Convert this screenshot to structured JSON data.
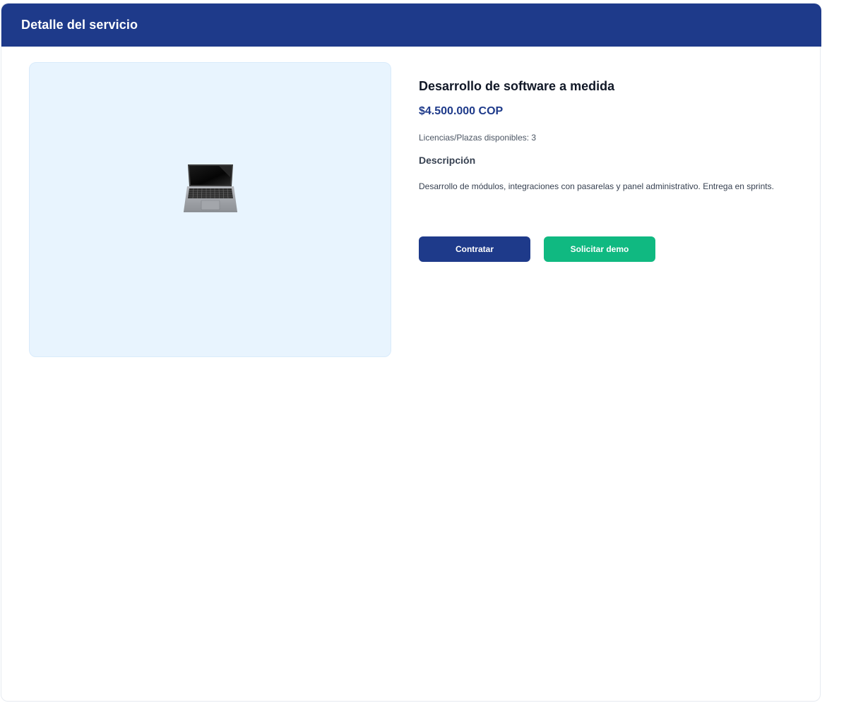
{
  "header": {
    "title": "Detalle del servicio"
  },
  "product": {
    "image_icon": "laptop-icon",
    "title": "Desarrollo de software a medida",
    "price": "$4.500.000 COP",
    "stock": "Licencias/Plazas disponibles: 3",
    "description_heading": "Descripción",
    "description": "Desarrollo de módulos, integraciones con pasarelas y panel administrativo. Entrega en sprints."
  },
  "actions": {
    "primary_label": "Contratar",
    "secondary_label": "Solicitar demo"
  },
  "colors": {
    "header_bg": "#1e3a8a",
    "price": "#1e3a8a",
    "primary_button": "#1e3a8a",
    "secondary_button": "#10b981",
    "image_panel_bg": "#e8f4fe"
  }
}
